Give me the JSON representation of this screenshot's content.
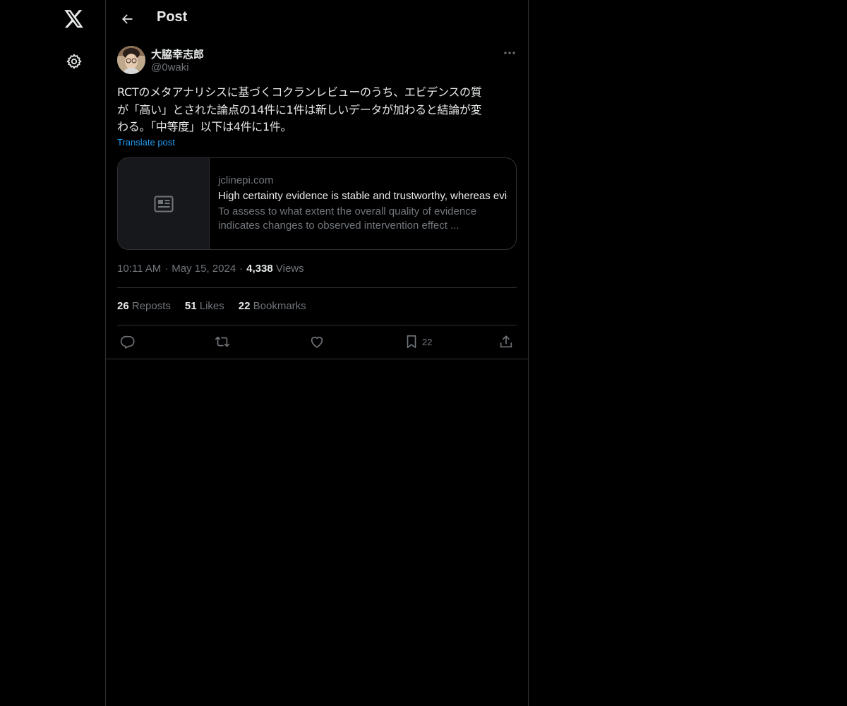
{
  "header": {
    "title": "Post"
  },
  "post": {
    "author": {
      "name": "大脇幸志郎",
      "handle": "@0waki"
    },
    "text_lines": [
      "RCTのメタアナリシスに基づくコクランレビューのうち、エビデンスの質",
      "が「高い」とされた論点の14件に1件は新しいデータが加わると結論が変",
      "わる。「中等度」以下は4件に1件。"
    ],
    "translate_label": "Translate post",
    "card": {
      "domain": "jclinepi.com",
      "title": "High certainty evidence is stable and trustworthy, whereas evidence of moderate or lower certainty may be equally prone to being unstable",
      "description_lines": [
        "To assess to what extent the overall quality of evidence",
        "indicates changes to observed intervention effect ..."
      ]
    },
    "time": "10:11 AM",
    "date": "May 15, 2024",
    "views_count": "4,338",
    "views_label": "Views",
    "stats": {
      "reposts_count": "26",
      "reposts_label": "Reposts",
      "likes_count": "51",
      "likes_label": "Likes",
      "bookmarks_count": "22",
      "bookmarks_label": "Bookmarks"
    },
    "actions": {
      "bookmark_count": "22"
    }
  },
  "icons": {
    "logo": "x-logo-icon",
    "settings": "gear-icon",
    "back": "arrow-left-icon",
    "more": "more-horizontal-icon",
    "card_thumb": "article-icon",
    "reply": "reply-icon",
    "repost": "repost-icon",
    "like": "heart-icon",
    "bookmark": "bookmark-icon",
    "share": "share-icon"
  },
  "colors": {
    "background": "#000000",
    "text_primary": "#e7e9ea",
    "text_secondary": "#71767b",
    "link": "#1d9bf0",
    "border": "#2f3336"
  }
}
